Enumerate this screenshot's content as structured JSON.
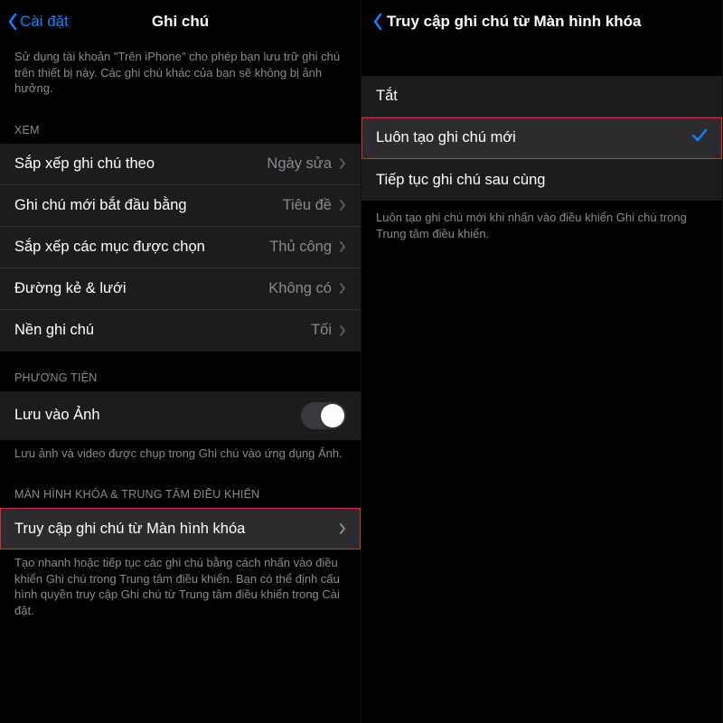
{
  "left": {
    "back": "Cài đặt",
    "title": "Ghi chú",
    "topDesc": "Sử dụng tài khoản \"Trên iPhone\" cho phép bạn lưu trữ ghi chú trên thiết bị này. Các ghi chú khác của bạn sẽ không bị ảnh hưởng.",
    "view": {
      "header": "XEM",
      "sort": {
        "label": "Sắp xếp ghi chú theo",
        "value": "Ngày sửa"
      },
      "startWith": {
        "label": "Ghi chú mới bắt đầu bằng",
        "value": "Tiêu đề"
      },
      "arrange": {
        "label": "Sắp xếp các mục được chọn",
        "value": "Thủ công"
      },
      "lines": {
        "label": "Đường kẻ & lưới",
        "value": "Không có"
      },
      "bg": {
        "label": "Nền ghi chú",
        "value": "Tối"
      }
    },
    "media": {
      "header": "PHƯƠNG TIỆN",
      "save": {
        "label": "Lưu vào Ảnh"
      },
      "desc": "Lưu ảnh và video được chụp trong Ghi chú vào ứng dụng Ảnh."
    },
    "lock": {
      "header": "MÀN HÌNH KHÓA & TRUNG TÂM ĐIỀU KHIỂN",
      "access": {
        "label": "Truy cập ghi chú từ Màn hình khóa"
      },
      "desc": "Tạo nhanh hoặc tiếp tục các ghi chú bằng cách nhấn vào điều khiển Ghi chú trong Trung tâm điều khiển. Bạn có thể định cấu hình quyền truy cập Ghi chú từ Trung tâm điều khiển trong Cài đặt."
    }
  },
  "right": {
    "title": "Truy cập ghi chú từ Màn hình khóa",
    "opts": {
      "off": "Tắt",
      "always": "Luôn tạo ghi chú mới",
      "resume": "Tiếp tục ghi chú sau cùng"
    },
    "desc": "Luôn tạo ghi chú mới khi nhấn vào điều khiển Ghi chú trong Trung tâm điều khiển."
  }
}
